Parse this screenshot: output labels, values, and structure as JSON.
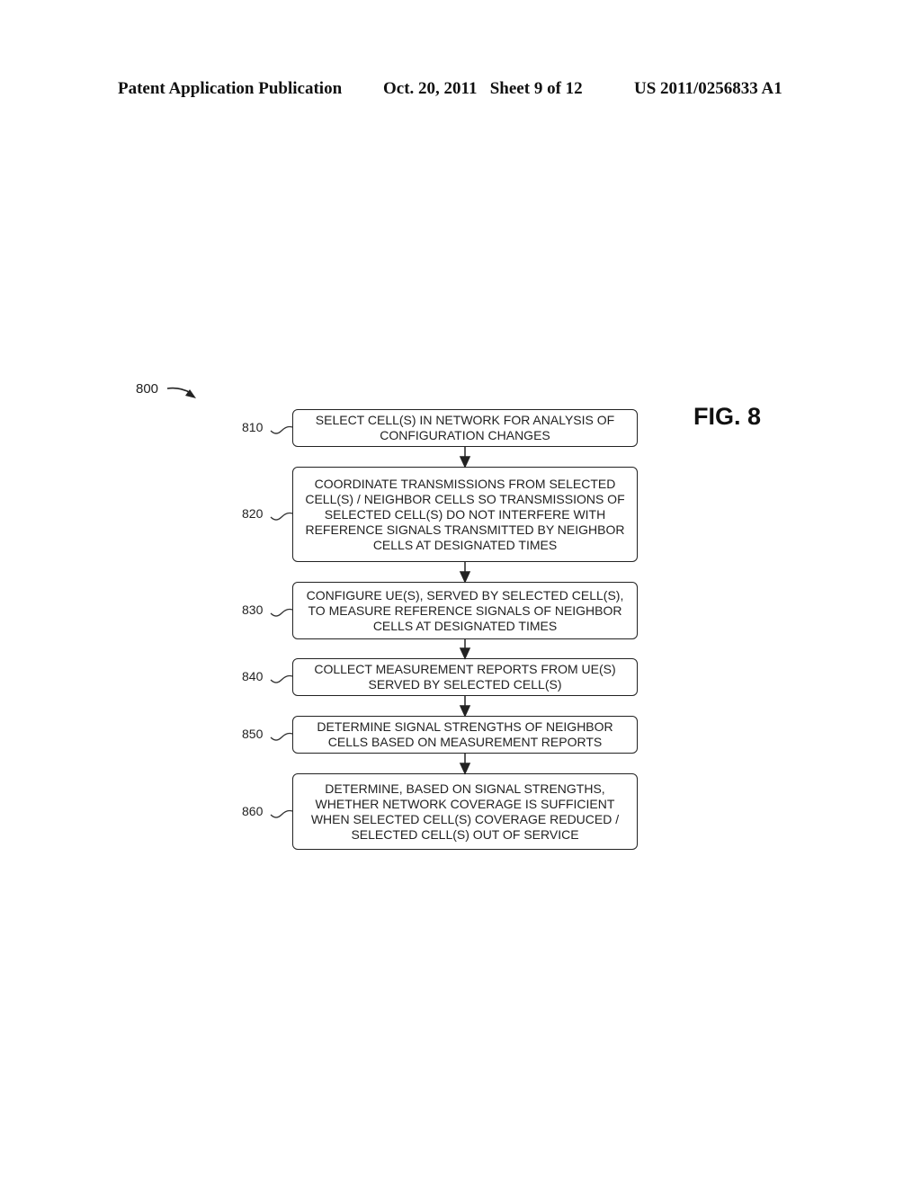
{
  "header": {
    "left": "Patent Application Publication",
    "middle": "Oct. 20, 2011   Sheet 9 of 12",
    "right": "US 2011/0256833 A1"
  },
  "figure": {
    "title": "FIG. 8",
    "reference": "800",
    "steps": [
      {
        "ref": "810",
        "text": "SELECT CELL(S) IN NETWORK FOR ANALYSIS OF\nCONFIGURATION CHANGES"
      },
      {
        "ref": "820",
        "text": "COORDINATE TRANSMISSIONS FROM SELECTED\nCELL(S) / NEIGHBOR CELLS SO TRANSMISSIONS OF\nSELECTED CELL(S) DO NOT INTERFERE WITH\nREFERENCE SIGNALS TRANSMITTED BY NEIGHBOR\nCELLS AT DESIGNATED TIMES"
      },
      {
        "ref": "830",
        "text": "CONFIGURE UE(S), SERVED BY SELECTED CELL(S),\nTO MEASURE REFERENCE SIGNALS OF NEIGHBOR\nCELLS AT DESIGNATED TIMES"
      },
      {
        "ref": "840",
        "text": "COLLECT MEASUREMENT REPORTS FROM UE(S)\nSERVED BY SELECTED CELL(S)"
      },
      {
        "ref": "850",
        "text": "DETERMINE SIGNAL STRENGTHS OF NEIGHBOR\nCELLS BASED ON MEASUREMENT REPORTS"
      },
      {
        "ref": "860",
        "text": "DETERMINE, BASED ON SIGNAL STRENGTHS,\nWHETHER NETWORK COVERAGE IS SUFFICIENT\nWHEN SELECTED CELL(S) COVERAGE REDUCED /\nSELECTED CELL(S) OUT OF SERVICE"
      }
    ]
  }
}
